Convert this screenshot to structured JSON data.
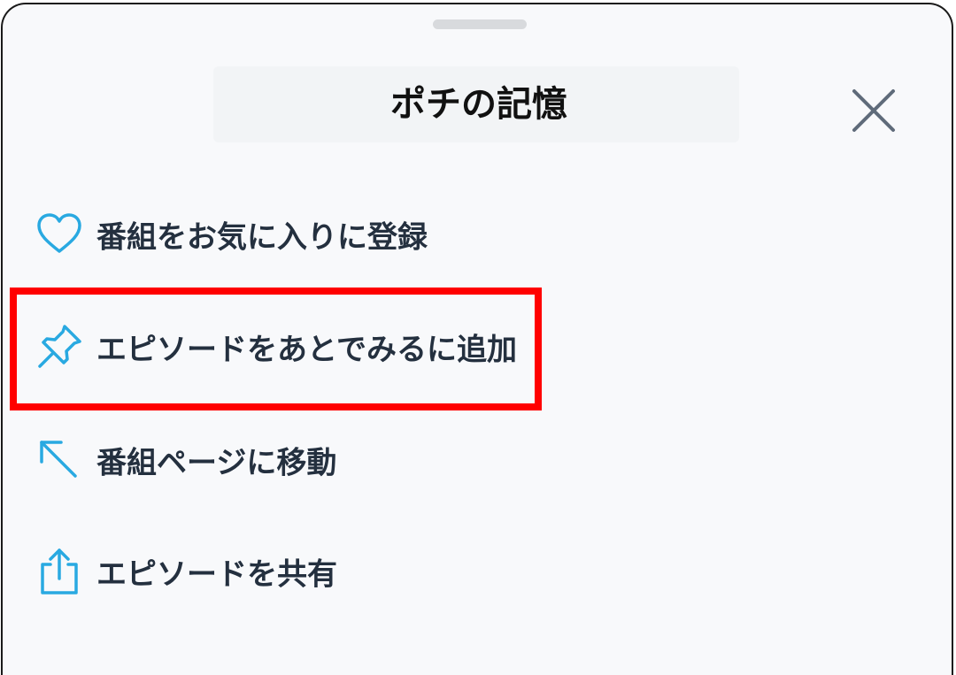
{
  "sheet": {
    "title": "ポチの記憶",
    "close_icon": "close-icon"
  },
  "menu": {
    "items": [
      {
        "label": "番組をお気に入りに登録",
        "icon": "heart-icon"
      },
      {
        "label": "エピソードをあとでみるに追加",
        "icon": "pin-icon"
      },
      {
        "label": "番組ページに移動",
        "icon": "arrow-up-left-icon"
      },
      {
        "label": "エピソードを共有",
        "icon": "share-icon"
      }
    ]
  },
  "colors": {
    "icon_accent": "#29a9e1",
    "label_text": "#24303f",
    "highlight": "#ff0000",
    "close_icon": "#5f6b7a"
  }
}
